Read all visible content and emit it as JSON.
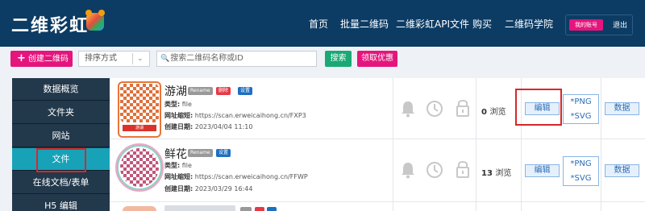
{
  "header": {
    "logo_text": "二维彩虹",
    "nav": [
      "首页",
      "批量二维码",
      "二维彩虹API文件",
      "购买",
      "二维码学院"
    ],
    "account_label": "我的账号",
    "logout_label": "退出"
  },
  "toolbar": {
    "create_label": "创建二维码",
    "sort_label": "排序方式",
    "search_placeholder": "搜索二维码名称或ID",
    "search_button": "搜索",
    "coupon_button": "领取优惠"
  },
  "sidebar": {
    "items": [
      "数据概览",
      "文件夹",
      "网站",
      "文件",
      "在线文档/表单",
      "H5 编辑"
    ],
    "active_index": 3
  },
  "labels": {
    "type": "类型:",
    "short_url": "网址缩短:",
    "created": "创建日期:",
    "views_suffix": "浏览",
    "edit": "编辑",
    "png": "*PNG",
    "svg": "*SVG",
    "data": "数据",
    "rename": "Rename",
    "delete": "删除",
    "settings": "设置"
  },
  "rows": [
    {
      "title": "游湖",
      "type": "file",
      "short_url": "https://scan.erweicaihong.cn/FXP3",
      "created": "2023/04/04 11:10",
      "views": "0",
      "qr_caption": "游湖",
      "qr_color": "#e0703a"
    },
    {
      "title": "鲜花",
      "type": "file",
      "short_url": "https://scan.erweicaihong.cn/FFWP",
      "created": "2023/03/29 16:44",
      "views": "13",
      "qr_color": "#c0577a"
    }
  ],
  "colors": {
    "header_bg": "#0c3c64",
    "accent_pink": "#e5157d",
    "green": "#19a974",
    "sidebar_bg": "#22384b",
    "sidebar_active": "#17a2b8",
    "highlight_red": "#d62828"
  }
}
